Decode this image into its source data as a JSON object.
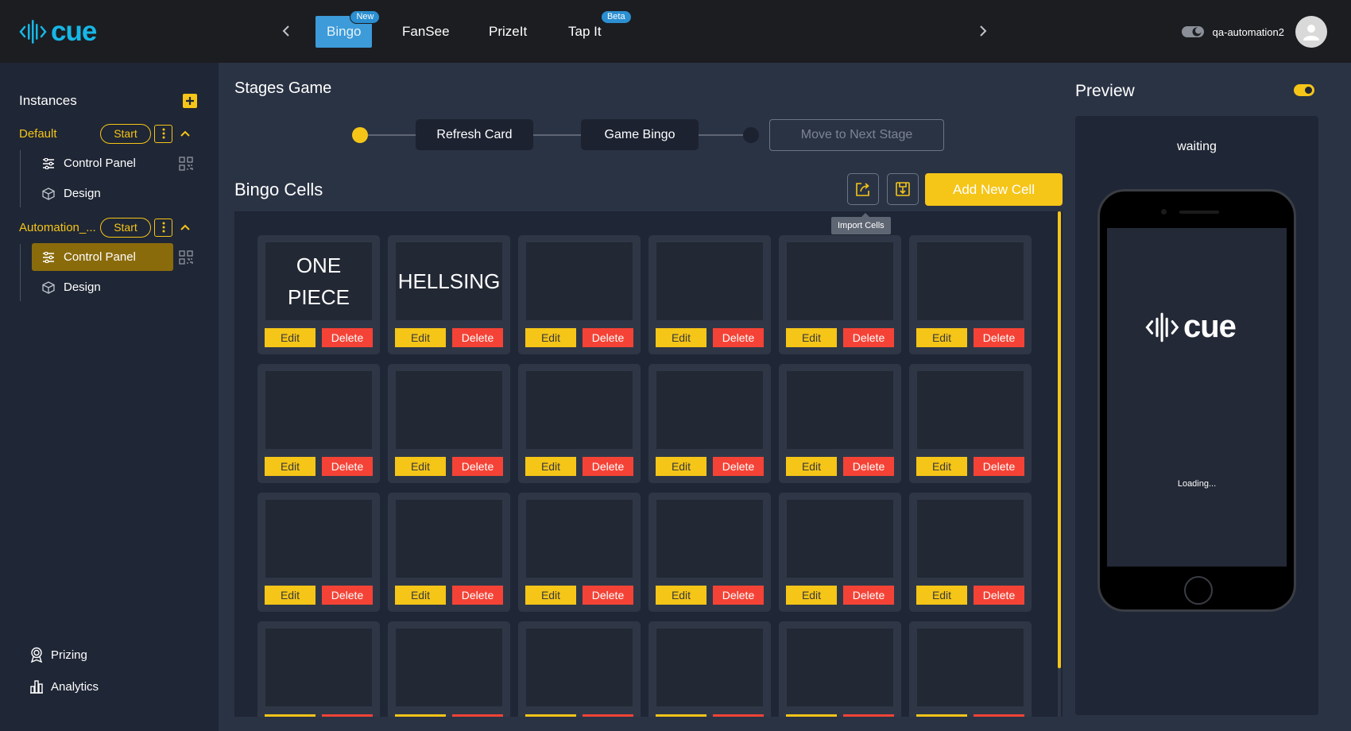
{
  "header": {
    "logo_text": "cue",
    "tabs": [
      {
        "label": "Bingo",
        "badge": "New",
        "active": true
      },
      {
        "label": "FanSee",
        "badge": "",
        "active": false
      },
      {
        "label": "PrizeIt",
        "badge": "",
        "active": false
      },
      {
        "label": "Tap It",
        "badge": "Beta",
        "active": false
      }
    ],
    "username": "qa-automation2"
  },
  "sidebar": {
    "header": "Instances",
    "instances": [
      {
        "name": "Default",
        "start_label": "Start",
        "items": [
          {
            "label": "Control Panel",
            "icon": "sliders-icon",
            "active": false
          },
          {
            "label": "Design",
            "icon": "cube-icon",
            "active": false
          }
        ]
      },
      {
        "name": "Automation_...",
        "start_label": "Start",
        "items": [
          {
            "label": "Control Panel",
            "icon": "sliders-icon",
            "active": true
          },
          {
            "label": "Design",
            "icon": "cube-icon",
            "active": false
          }
        ]
      }
    ],
    "bottom_links": [
      {
        "label": "Prizing",
        "icon": "award-icon"
      },
      {
        "label": "Analytics",
        "icon": "bar-chart-icon"
      }
    ]
  },
  "main": {
    "stages_title": "Stages Game",
    "stages": [
      {
        "label": "Refresh Card"
      },
      {
        "label": "Game Bingo"
      }
    ],
    "next_stage_label": "Move to Next Stage",
    "cells_title": "Bingo Cells",
    "tooltip": "Import Cells",
    "add_cell_label": "Add New Cell",
    "edit_label": "Edit",
    "delete_label": "Delete",
    "cells": [
      "ONE PIECE",
      "HELLSING",
      "",
      "",
      "",
      "",
      "",
      "",
      "",
      "",
      "",
      "",
      "",
      "",
      "",
      "",
      "",
      "",
      "",
      "",
      "",
      "",
      "",
      ""
    ]
  },
  "preview": {
    "title": "Preview",
    "status": "waiting",
    "logo_text": "cue",
    "loading_text": "Loading..."
  },
  "colors": {
    "accent": "#f5c518",
    "brand": "#17b7e6",
    "danger": "#f44336",
    "active_tab": "#3d9bd9"
  }
}
